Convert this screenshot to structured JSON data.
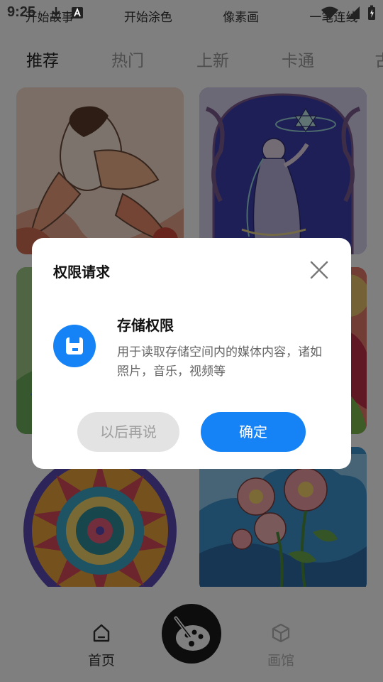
{
  "status_bar": {
    "time": "9:25"
  },
  "top_categories": [
    "开始故事",
    "开始涂色",
    "像素画",
    "一笔连线"
  ],
  "tabs": [
    {
      "label": "推荐",
      "active": true
    },
    {
      "label": "热门",
      "active": false
    },
    {
      "label": "上新",
      "active": false
    },
    {
      "label": "卡通",
      "active": false
    },
    {
      "label": "古",
      "active": false
    }
  ],
  "artworks": [
    {
      "name": "fairy-lady",
      "color": "#f1c9b8"
    },
    {
      "name": "mystic-goddess",
      "color": "#5f54c8"
    },
    {
      "name": "green-scene",
      "color": "#8fc47a"
    },
    {
      "name": "floral-red",
      "color": "#c5465e"
    },
    {
      "name": "mandala",
      "color": "#7f5fc0"
    },
    {
      "name": "peony-flowers",
      "color": "#4ea3d8"
    }
  ],
  "bottom_nav": {
    "home_label": "首页",
    "gallery_label": "画馆"
  },
  "dialog": {
    "title": "权限请求",
    "permission_title": "存储权限",
    "permission_desc": "用于读取存储空间内的媒体内容，诸如照片，音乐，视频等",
    "later_label": "以后再说",
    "confirm_label": "确定"
  },
  "colors": {
    "accent": "#1583f5",
    "overlay": "rgba(0,0,0,0.5)"
  }
}
